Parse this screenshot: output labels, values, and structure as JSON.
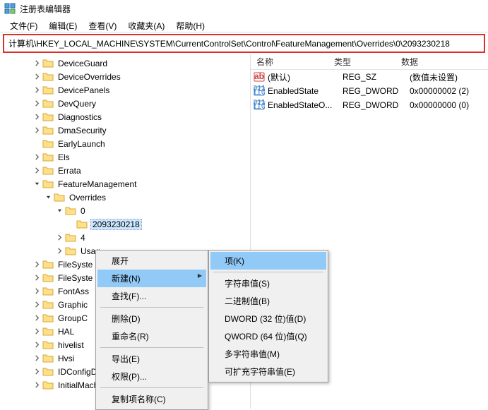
{
  "title": "注册表编辑器",
  "menubar": [
    "文件(F)",
    "编辑(E)",
    "查看(V)",
    "收藏夹(A)",
    "帮助(H)"
  ],
  "address": "计算机\\HKEY_LOCAL_MACHINE\\SYSTEM\\CurrentControlSet\\Control\\FeatureManagement\\Overrides\\0\\2093230218",
  "tree": [
    {
      "ind": 46,
      "chev": ">",
      "label": "DeviceGuard"
    },
    {
      "ind": 46,
      "chev": ">",
      "label": "DeviceOverrides"
    },
    {
      "ind": 46,
      "chev": ">",
      "label": "DevicePanels"
    },
    {
      "ind": 46,
      "chev": ">",
      "label": "DevQuery"
    },
    {
      "ind": 46,
      "chev": ">",
      "label": "Diagnostics"
    },
    {
      "ind": 46,
      "chev": ">",
      "label": "DmaSecurity"
    },
    {
      "ind": 46,
      "chev": "",
      "label": "EarlyLaunch"
    },
    {
      "ind": 46,
      "chev": ">",
      "label": "Els"
    },
    {
      "ind": 46,
      "chev": ">",
      "label": "Errata"
    },
    {
      "ind": 46,
      "chev": "v",
      "label": "FeatureManagement"
    },
    {
      "ind": 62,
      "chev": "v",
      "label": "Overrides"
    },
    {
      "ind": 78,
      "chev": "v",
      "label": "0"
    },
    {
      "ind": 94,
      "chev": "",
      "label": "2093230218",
      "selected": true
    },
    {
      "ind": 78,
      "chev": ">",
      "label": "4"
    },
    {
      "ind": 78,
      "chev": ">",
      "label": "Usag"
    },
    {
      "ind": 46,
      "chev": ">",
      "label": "FileSyste"
    },
    {
      "ind": 46,
      "chev": ">",
      "label": "FileSyste"
    },
    {
      "ind": 46,
      "chev": ">",
      "label": "FontAss"
    },
    {
      "ind": 46,
      "chev": ">",
      "label": "Graphic"
    },
    {
      "ind": 46,
      "chev": ">",
      "label": "GroupC"
    },
    {
      "ind": 46,
      "chev": ">",
      "label": "HAL"
    },
    {
      "ind": 46,
      "chev": ">",
      "label": "hivelist"
    },
    {
      "ind": 46,
      "chev": ">",
      "label": "Hvsi"
    },
    {
      "ind": 46,
      "chev": ">",
      "label": "IDConfigDB"
    },
    {
      "ind": 46,
      "chev": ">",
      "label": "InitialMachineConfig"
    }
  ],
  "columns": {
    "name": "名称",
    "type": "类型",
    "data": "数据"
  },
  "values": [
    {
      "icon": "sz",
      "name": "(默认)",
      "type": "REG_SZ",
      "data": "(数值未设置)"
    },
    {
      "icon": "dw",
      "name": "EnabledState",
      "type": "REG_DWORD",
      "data": "0x00000002 (2)"
    },
    {
      "icon": "dw",
      "name": "EnabledStateO...",
      "type": "REG_DWORD",
      "data": "0x00000000 (0)"
    }
  ],
  "ctx1": [
    {
      "label": "展开"
    },
    {
      "label": "新建(N)",
      "hl": true,
      "sub": true
    },
    {
      "label": "查找(F)..."
    },
    {
      "sep": true
    },
    {
      "label": "删除(D)"
    },
    {
      "label": "重命名(R)"
    },
    {
      "sep": true
    },
    {
      "label": "导出(E)"
    },
    {
      "label": "权限(P)..."
    },
    {
      "sep": true
    },
    {
      "label": "复制项名称(C)"
    }
  ],
  "ctx2": [
    {
      "label": "项(K)",
      "hl": true
    },
    {
      "sep": true
    },
    {
      "label": "字符串值(S)"
    },
    {
      "label": "二进制值(B)"
    },
    {
      "label": "DWORD (32 位)值(D)"
    },
    {
      "label": "QWORD (64 位)值(Q)"
    },
    {
      "label": "多字符串值(M)"
    },
    {
      "label": "可扩充字符串值(E)"
    }
  ]
}
